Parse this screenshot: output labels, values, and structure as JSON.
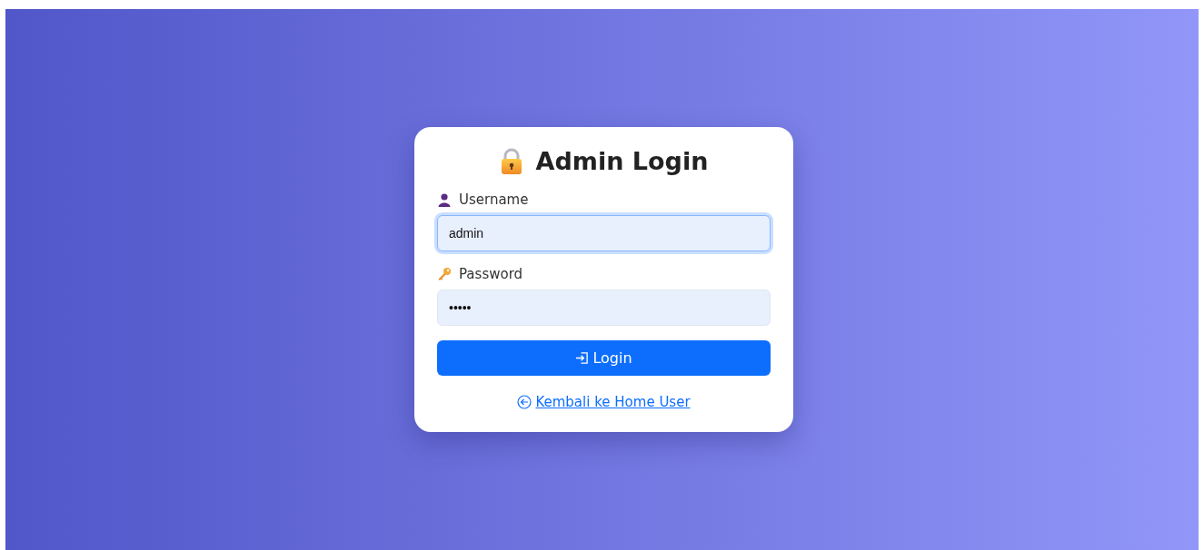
{
  "title": "Admin Login",
  "fields": [
    {
      "label": "Username",
      "kind": "text",
      "value": "admin",
      "focused": true
    },
    {
      "label": "Password",
      "kind": "password",
      "value": "•••••",
      "focused": false
    }
  ],
  "button": {
    "label": "Login"
  },
  "back_link": {
    "label": "Kembali ke Home User"
  }
}
